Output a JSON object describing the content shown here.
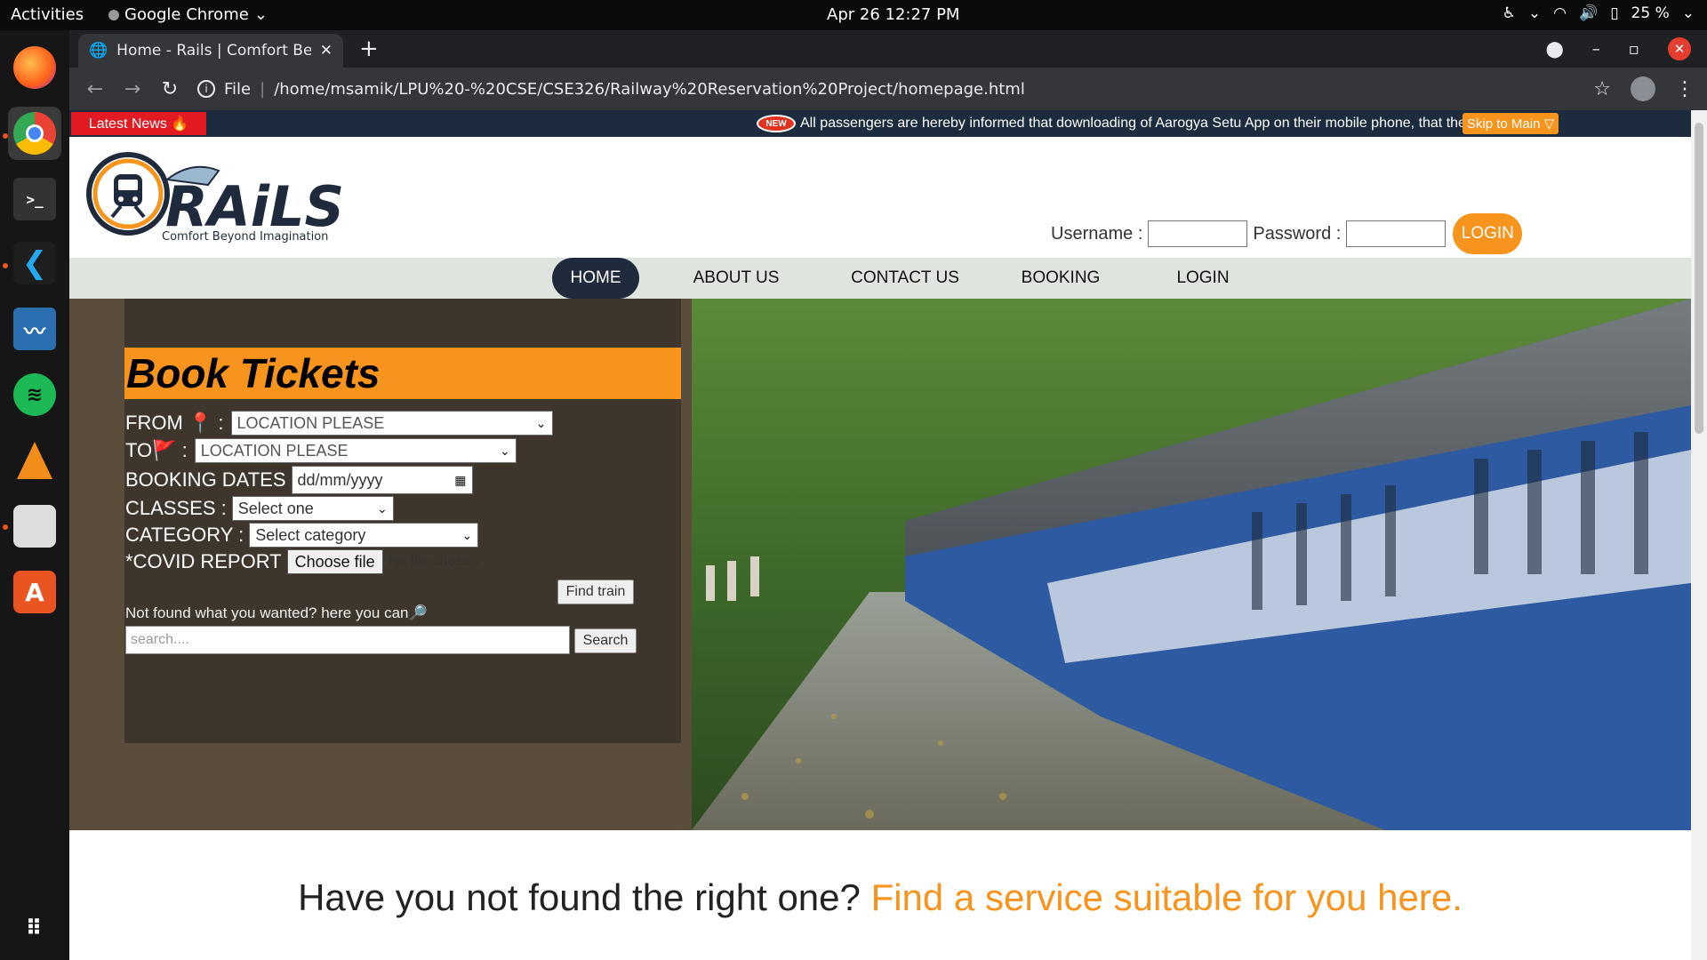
{
  "topbar": {
    "activities": "Activities",
    "app_name": "Google Chrome",
    "clock": "Apr 26  12:27 PM",
    "battery": "25 %"
  },
  "dock": {
    "items": [
      "firefox-icon",
      "chrome-icon",
      "terminal-icon",
      "vscode-icon",
      "system-monitor-icon",
      "spotify-icon",
      "vlc-icon",
      "files-icon",
      "software-center-icon",
      "show-apps-icon"
    ]
  },
  "browser": {
    "tab_title": "Home - Rails | Comfort Be",
    "url_scheme": "File",
    "url": "/home/msamik/LPU%20-%20CSE/CSE326/Railway%20Reservation%20Project/homepage.html"
  },
  "ticker": {
    "label": "Latest News 🔥",
    "new_badge": "NEW",
    "text": "All passengers are hereby informed that downloading of Aarogya Setu App on their mobile phone, that the",
    "skip": "Skip to Main ▽"
  },
  "header": {
    "logo_text": "RAiLS",
    "tagline": "Comfort Beyond Imagination",
    "username_label": "Username :",
    "password_label": "Password :",
    "login_button": "LOGIN"
  },
  "nav": {
    "items": [
      "HOME",
      "ABOUT US",
      "CONTACT US",
      "BOOKING",
      "LOGIN"
    ]
  },
  "booking": {
    "title": "Book Tickets",
    "from_label": "FROM 📍 :",
    "from_value": "LOCATION PLEASE",
    "to_label": "TO🚩 :",
    "to_value": "LOCATION PLEASE",
    "dates_label": "BOOKING DATES",
    "dates_placeholder": "dd/mm/yyyy",
    "classes_label": "CLASSES :",
    "classes_value": "Select one",
    "category_label": "CATEGORY :",
    "category_value": "Select category",
    "covid_label": "*COVID REPORT",
    "file_button": "Choose file",
    "no_file": "No file chosen",
    "find_button": "Find train",
    "hint": "Not found what you wanted? here you can🔎",
    "search_placeholder": "search....",
    "search_button": "Search"
  },
  "section": {
    "heading_dark": "Have you not found the right one?",
    "heading_accent": "Find a service suitable for you here."
  },
  "colors": {
    "accent": "#f7941d",
    "nav_active": "#1f2b3c",
    "ticker_bg": "#1c2b3d",
    "news_red": "#e21b23"
  }
}
